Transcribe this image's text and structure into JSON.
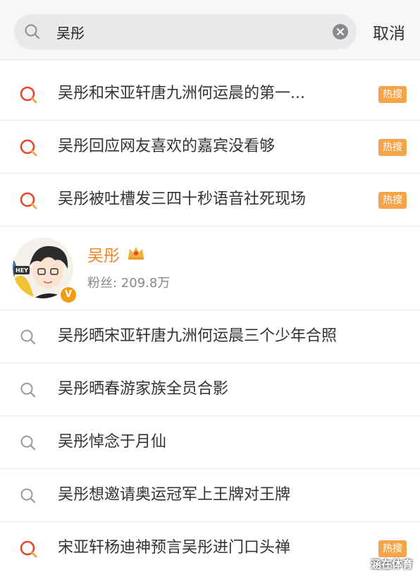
{
  "search": {
    "value": "吴彤",
    "cancel_label": "取消"
  },
  "badge_label": "热搜",
  "colors": {
    "accent": "#f0862c",
    "badge": "#f5a44a",
    "hot_icon": "#e8452c"
  },
  "suggestions_top": [
    {
      "text": "吴彤和宋亚轩唐九洲何运晨的第一...",
      "hot": true
    },
    {
      "text": "吴彤回应网友喜欢的嘉宾没看够",
      "hot": true
    },
    {
      "text": "吴彤被吐槽发三四十秒语音社死现场",
      "hot": true
    }
  ],
  "user": {
    "name": "吴彤",
    "fans_label": "粉丝: 209.8万",
    "verified_mark": "V",
    "avatar_text": "HEY"
  },
  "suggestions_bottom": [
    {
      "text": "吴彤晒宋亚轩唐九洲何运晨三个少年合照",
      "hot": false
    },
    {
      "text": "吴彤晒春游家族全员合影",
      "hot": false
    },
    {
      "text": "吴彤悼念于月仙",
      "hot": false
    },
    {
      "text": "吴彤想邀请奥运冠军上王牌对王牌",
      "hot": false
    },
    {
      "text": "宋亚轩杨迪神预言吴彤进门口头禅",
      "hot": true
    }
  ],
  "watermark": "涵在体育"
}
